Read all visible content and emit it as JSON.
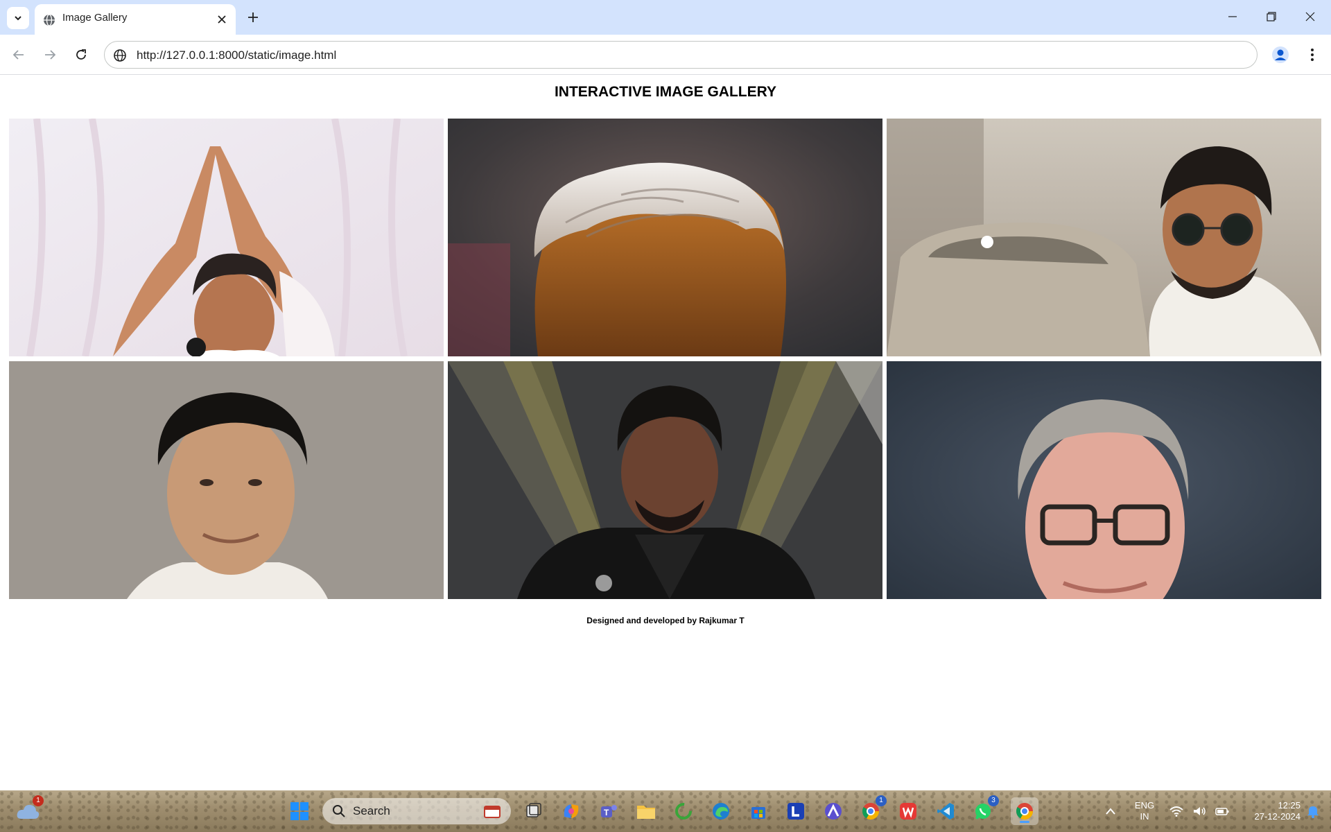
{
  "browser": {
    "tab_title": "Image Gallery",
    "url": "http://127.0.0.1:8000/static/image.html"
  },
  "page": {
    "title": "INTERACTIVE IMAGE GALLERY",
    "images": [
      {
        "icon": "portrait-photo"
      },
      {
        "icon": "portrait-photo"
      },
      {
        "icon": "portrait-photo"
      },
      {
        "icon": "portrait-photo"
      },
      {
        "icon": "portrait-photo"
      },
      {
        "icon": "portrait-photo"
      }
    ],
    "footer": "Designed and developed by Rajkumar T"
  },
  "taskbar": {
    "search_placeholder": "Search",
    "weather_badge": "1",
    "chrome_badge": "1",
    "whatsapp_badge": "3",
    "language_line1": "ENG",
    "language_line2": "IN",
    "time": "12:25",
    "date": "27-12-2024"
  },
  "colors": {
    "tabbar_bg": "#d3e3fd",
    "taskbar_bg": "#a08f70"
  }
}
